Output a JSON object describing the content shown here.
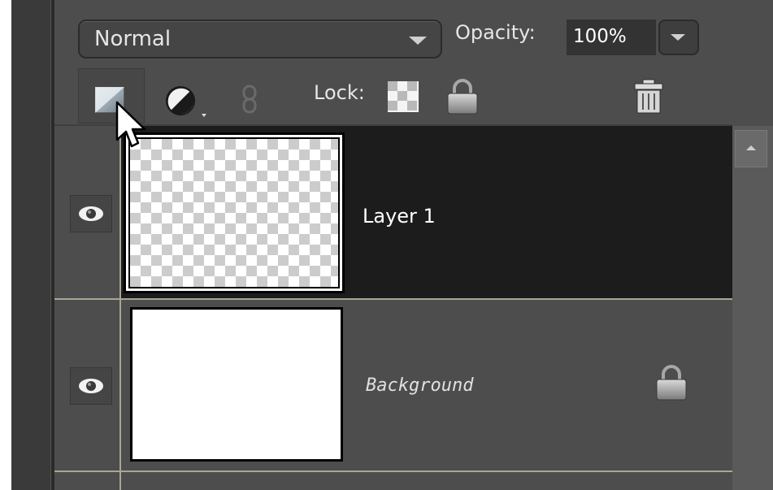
{
  "layers_panel": {
    "blend_mode": {
      "value": "Normal"
    },
    "opacity": {
      "label": "Opacity:",
      "value": "100%"
    },
    "toolbar": {
      "new_layer_icon": "new-layer-icon",
      "adjustment_icon": "adjustment-layer-icon",
      "link_icon": "link-icon",
      "lock_label": "Lock:",
      "lock_transparent_icon": "lock-transparent-pixels-icon",
      "lock_all_icon": "lock-icon",
      "delete_icon": "trash-icon"
    },
    "layers": [
      {
        "name": "Layer 1",
        "visible_icon": "eye-icon",
        "selected": true,
        "thumbnail": "transparent"
      },
      {
        "name": "Background",
        "visible_icon": "eye-icon",
        "selected": false,
        "thumbnail": "white",
        "locked_icon": "lock-icon"
      }
    ]
  },
  "colors": {
    "panel_bg": "#4d4d4d",
    "selected_row": "#1c1c1c",
    "separator": "#a9a694",
    "text": "#e6e6e6"
  }
}
